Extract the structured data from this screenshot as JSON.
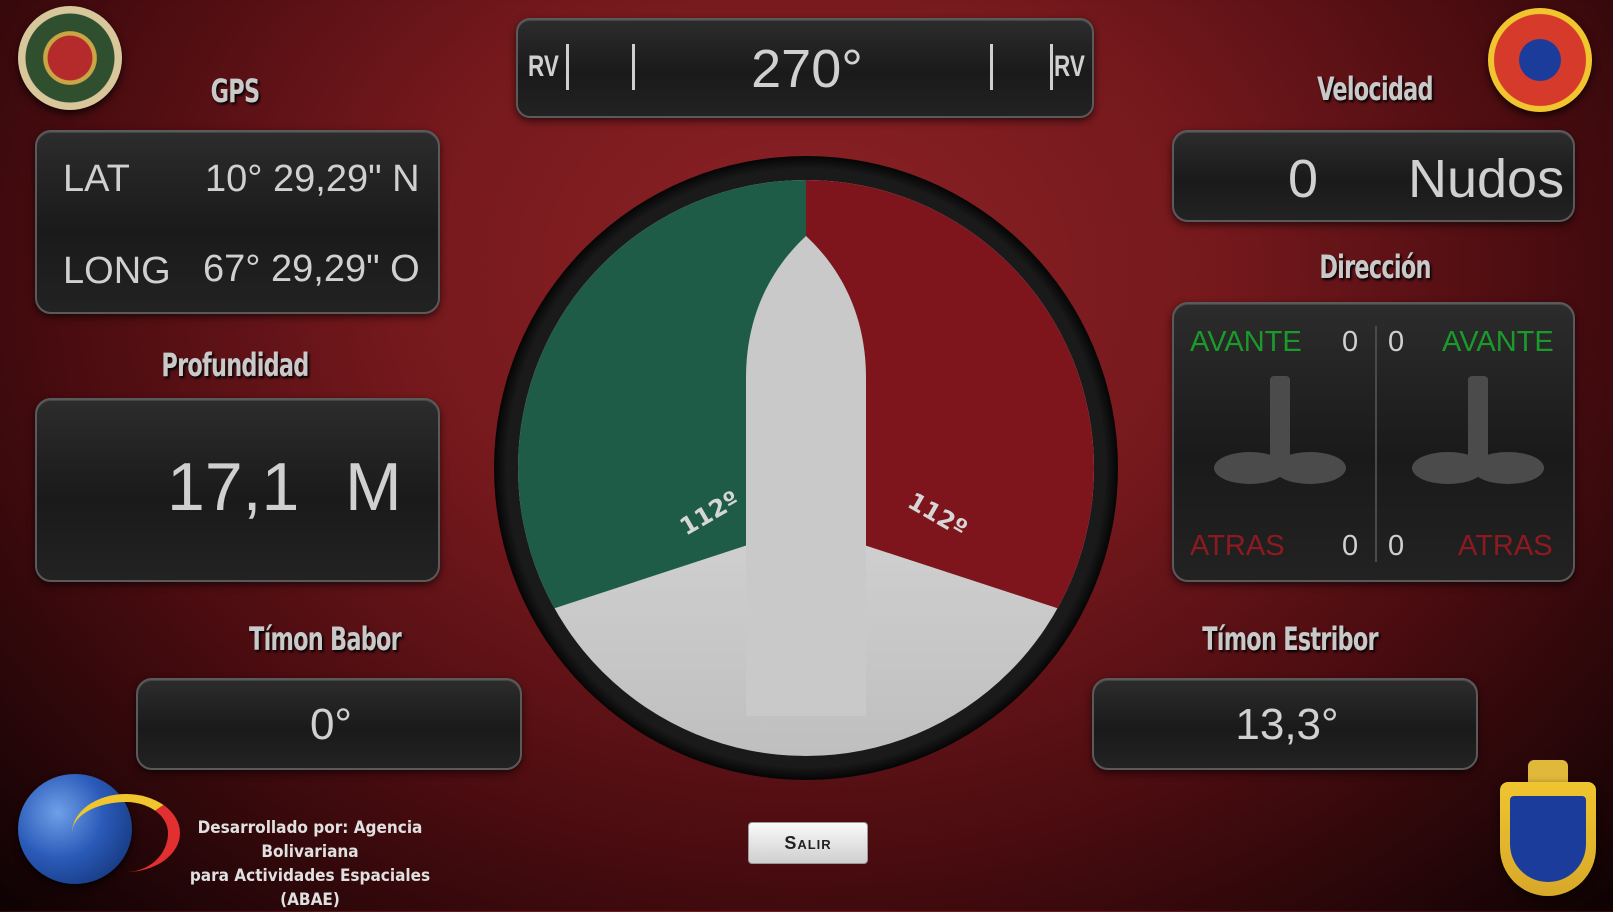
{
  "heading": {
    "left_label": "RV",
    "right_label": "RV",
    "value": "270°"
  },
  "gps": {
    "title": "GPS",
    "lat_label": "LAT",
    "lat_value": "10° 29,29\" N",
    "long_label": "LONG",
    "long_value": "67° 29,29\" O"
  },
  "depth": {
    "title": "Profundidad",
    "value": "17,1",
    "unit": "M"
  },
  "speed": {
    "title": "Velocidad",
    "value": "0",
    "unit": "Nudos"
  },
  "direction": {
    "title": "Dirección",
    "left": {
      "forward_label": "AVANTE",
      "forward_value": "0",
      "back_label": "ATRAS",
      "back_value": "0"
    },
    "right": {
      "forward_label": "AVANTE",
      "forward_value": "0",
      "back_label": "ATRAS",
      "back_value": "0"
    }
  },
  "rudder_port": {
    "title": "Tímon Babor",
    "value": "0°"
  },
  "rudder_starboard": {
    "title": "Tímon Estribor",
    "value": "13,3°"
  },
  "gauge": {
    "left_angle": "112º",
    "right_angle": "112º"
  },
  "credits": {
    "line1": "Desarrollado por: Agencia Bolivariana",
    "line2": "para Actividades Espaciales (ABAE)"
  },
  "exit_button": "Salir",
  "colors": {
    "port_green": "#1f5c47",
    "starboard_red": "#7e151c",
    "avante_green": "#1a9a2a",
    "atras_red": "#8e1a1f"
  }
}
